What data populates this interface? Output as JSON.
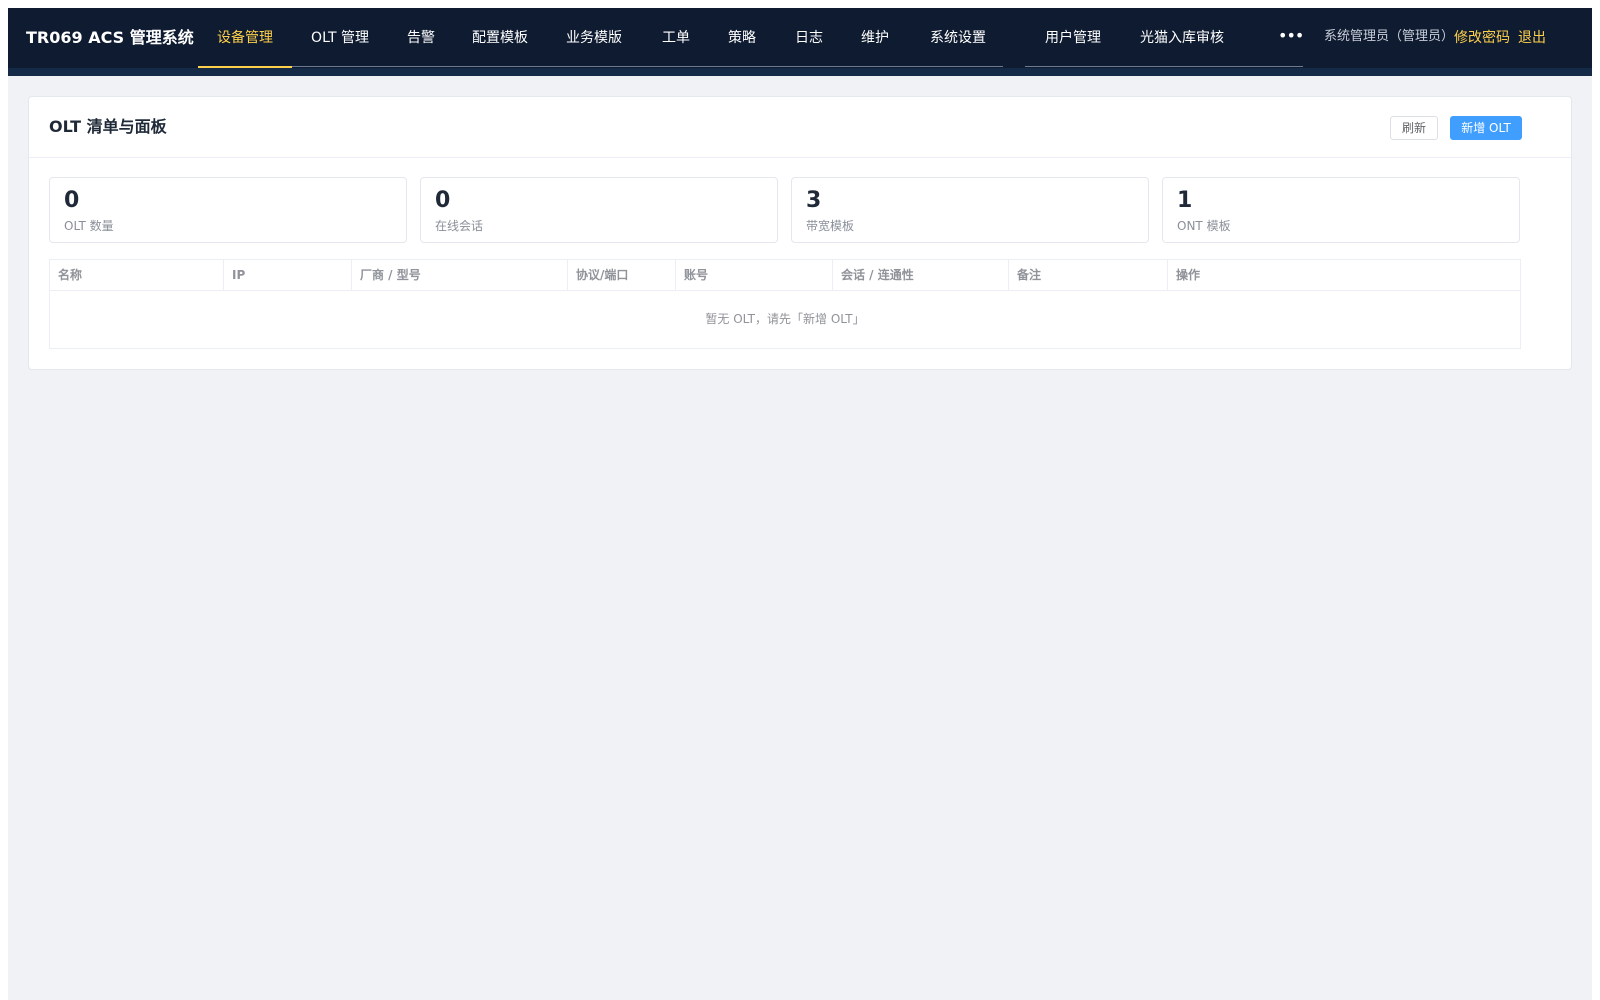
{
  "app": {
    "title": "TR069 ACS 管理系统"
  },
  "nav": {
    "items": [
      {
        "label": "设备管理",
        "active": true
      },
      {
        "label": "OLT 管理"
      },
      {
        "label": "告警"
      },
      {
        "label": "配置模板"
      },
      {
        "label": "业务模版"
      },
      {
        "label": "工单"
      },
      {
        "label": "策略"
      },
      {
        "label": "日志"
      },
      {
        "label": "维护"
      },
      {
        "label": "系统设置"
      },
      {
        "label": "用户管理"
      },
      {
        "label": "光猫入库审核"
      }
    ],
    "more_icon": "more-dots-icon",
    "more_glyph": "•••"
  },
  "user": {
    "display": "系统管理员（管理员）",
    "change_password": "修改密码",
    "logout": "退出"
  },
  "card": {
    "title": "OLT 清单与面板",
    "refresh_label": "刷新",
    "add_label": "新增 OLT"
  },
  "stats": [
    {
      "value": "0",
      "label": "OLT 数量"
    },
    {
      "value": "0",
      "label": "在线会话"
    },
    {
      "value": "3",
      "label": "带宽模板"
    },
    {
      "value": "1",
      "label": "ONT 模板"
    }
  ],
  "table": {
    "columns": [
      "名称",
      "IP",
      "厂商 / 型号",
      "协议/端口",
      "账号",
      "会话 / 连通性",
      "备注",
      "操作"
    ],
    "empty_text": "暂无 OLT，请先「新增 OLT」"
  },
  "colors": {
    "nav_bg": "#0e1b30",
    "accent": "#ffd04b",
    "primary": "#409eff",
    "page_bg": "#f0f2f5"
  }
}
